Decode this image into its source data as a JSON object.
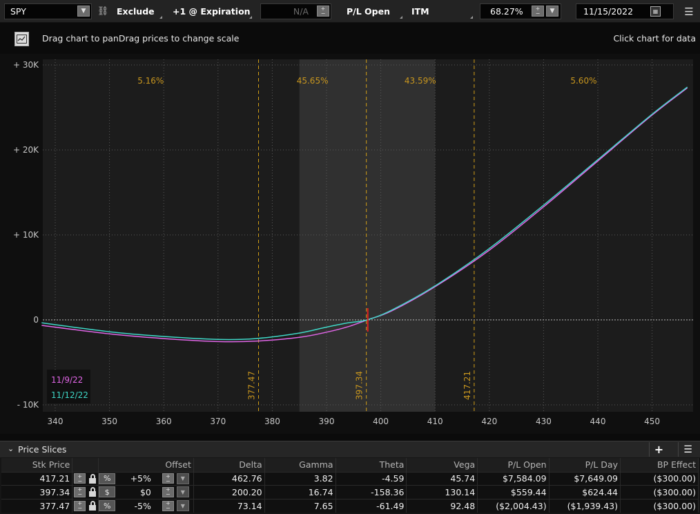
{
  "toolbar": {
    "symbol": "SPY",
    "exclude_label": "Exclude",
    "expiration_label": "+1 @ Expiration",
    "na_value": "N/A",
    "pl_open_label": "P/L Open",
    "itm_label": "ITM",
    "probability_value": "68.27%",
    "date_value": "11/15/2022"
  },
  "chart_header": {
    "drag_hint": "Drag chart to panDrag prices to change scale",
    "click_hint": "Click chart for data"
  },
  "chart_data": {
    "type": "line",
    "x_ticks": [
      340,
      350,
      360,
      370,
      380,
      390,
      400,
      410,
      420,
      430,
      440,
      450
    ],
    "y_ticks": [
      {
        "value": 30000,
        "label": "+ 30K"
      },
      {
        "value": 20000,
        "label": "+ 20K"
      },
      {
        "value": 10000,
        "label": "+ 10K"
      },
      {
        "value": 0,
        "label": "0"
      },
      {
        "value": -10000,
        "label": "- 10K"
      }
    ],
    "xlim": [
      337.5,
      458.5
    ],
    "ylim": [
      -10000,
      30000
    ],
    "zones": [
      {
        "label": "5.16%"
      },
      {
        "label": "45.65%"
      },
      {
        "label": "43.59%"
      },
      {
        "label": "5.60%"
      }
    ],
    "shaded_range": [
      385,
      410
    ],
    "price_lines": [
      {
        "value": 377.47,
        "label": "377.47"
      },
      {
        "value": 397.34,
        "label": "397.34"
      },
      {
        "value": 417.21,
        "label": "417.21"
      }
    ],
    "current_price": 397.6,
    "series": [
      {
        "name": "11/9/22",
        "color": "#e266e8",
        "x": [
          337.5,
          350,
          360,
          370,
          377,
          385,
          390,
          394,
          397.5,
          402,
          410,
          420,
          430,
          440,
          450,
          456.5
        ],
        "y": [
          -650,
          -1650,
          -2200,
          -2550,
          -2500,
          -2050,
          -1450,
          -800,
          0,
          1050,
          3900,
          8200,
          13300,
          18700,
          24100,
          27300
        ]
      },
      {
        "name": "11/12/22",
        "color": "#3fd8c8",
        "x": [
          337.5,
          350,
          360,
          370,
          377,
          385,
          390,
          394,
          397.5,
          402,
          410,
          420,
          430,
          440,
          450,
          456.5
        ],
        "y": [
          -350,
          -1400,
          -1950,
          -2300,
          -2200,
          -1550,
          -850,
          -350,
          0,
          1150,
          4000,
          8400,
          13500,
          18850,
          24200,
          27400
        ]
      }
    ],
    "grid": true
  },
  "price_slices": {
    "title": "Price Slices",
    "columns": [
      "Stk Price",
      "Offset",
      "Delta",
      "Gamma",
      "Theta",
      "Vega",
      "P/L Open",
      "P/L Day",
      "BP Effect"
    ],
    "rows": [
      {
        "stk_price": "417.21",
        "unit": "%",
        "offset": "+5%",
        "delta": "462.76",
        "gamma": "3.82",
        "theta": "-4.59",
        "vega": "45.74",
        "pl_open": "$7,584.09",
        "pl_day": "$7,649.09",
        "bp_effect": "($300.00)"
      },
      {
        "stk_price": "397.34",
        "unit": "$",
        "offset": "$0",
        "delta": "200.20",
        "gamma": "16.74",
        "theta": "-158.36",
        "vega": "130.14",
        "pl_open": "$559.44",
        "pl_day": "$624.44",
        "bp_effect": "($300.00)"
      },
      {
        "stk_price": "377.47",
        "unit": "%",
        "offset": "-5%",
        "delta": "73.14",
        "gamma": "7.65",
        "theta": "-61.49",
        "vega": "92.48",
        "pl_open": "($2,004.43)",
        "pl_day": "($1,939.43)",
        "bp_effect": "($300.00)"
      }
    ]
  },
  "colors": {
    "zone_label": "#c8961e",
    "price_line": "#d4a017",
    "current_marker": "#e02020",
    "background": "#1c1c1c",
    "shaded_zone": "#303030"
  }
}
